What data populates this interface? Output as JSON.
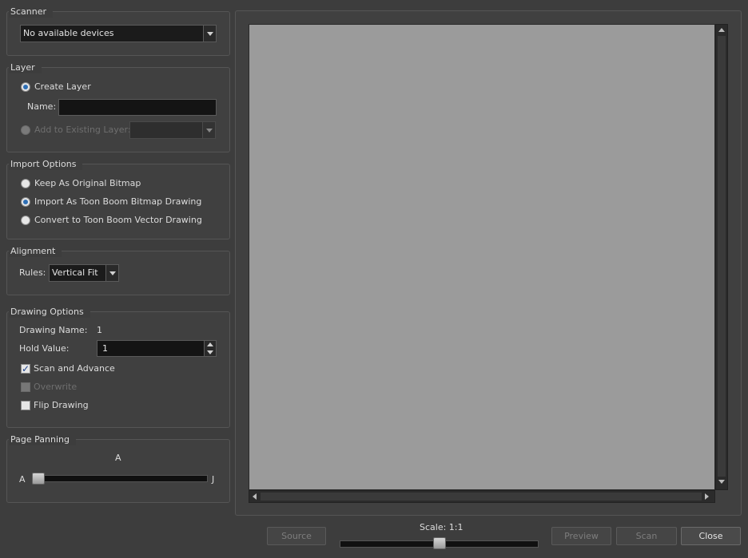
{
  "scanner": {
    "title": "Scanner",
    "device_value": "No available devices"
  },
  "layer": {
    "title": "Layer",
    "create_layer_label": "Create Layer",
    "name_label": "Name:",
    "name_value": "",
    "add_existing_label": "Add to Existing Layer:",
    "existing_value": ""
  },
  "import_options": {
    "title": "Import Options",
    "options": [
      {
        "label": "Keep As Original Bitmap",
        "checked": false
      },
      {
        "label": "Import As Toon Boom Bitmap Drawing",
        "checked": true
      },
      {
        "label": "Convert to Toon Boom Vector Drawing",
        "checked": false
      }
    ]
  },
  "alignment": {
    "title": "Alignment",
    "rules_label": "Rules:",
    "rules_value": "Vertical Fit"
  },
  "drawing_options": {
    "title": "Drawing Options",
    "drawing_name_label": "Drawing Name:",
    "drawing_name_value": "1",
    "hold_value_label": "Hold Value:",
    "hold_value": "1",
    "scan_advance_label": "Scan and Advance",
    "scan_advance_checked": true,
    "overwrite_label": "Overwrite",
    "overwrite_checked": false,
    "flip_label": "Flip Drawing",
    "flip_checked": false
  },
  "page_panning": {
    "title": "Page Panning",
    "top_label": "A",
    "left_label": "A",
    "right_label": "J",
    "position": 0.0
  },
  "footer": {
    "source_label": "Source",
    "scale_label": "Scale: 1:1",
    "scale_position": 0.5,
    "preview_label": "Preview",
    "scan_label": "Scan",
    "close_label": "Close"
  },
  "colors": {
    "background": "#3d3d3d",
    "preview_canvas": "#9b9b9b",
    "radio_accent": "#2e6fb5"
  }
}
